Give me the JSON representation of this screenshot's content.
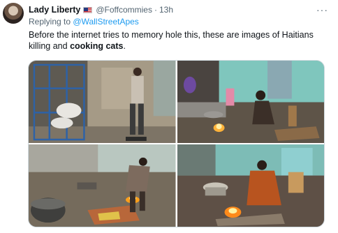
{
  "author": {
    "name": "Lady Liberty",
    "flag_icon": "us-flag-icon",
    "handle": "@Foffcommies",
    "separator": "·",
    "time": "13h"
  },
  "more_label": "···",
  "reply": {
    "prefix": "Replying to ",
    "mention": "@WallStreetApes"
  },
  "text": {
    "part1": "Before the internet tries to memory hole this, these are images of Haitians killing and ",
    "bold": "cooking cats",
    "part2": "."
  },
  "colors": {
    "text": "#0f1419",
    "secondary": "#536471",
    "link": "#1d9bf0",
    "border": "#cfd9de"
  }
}
